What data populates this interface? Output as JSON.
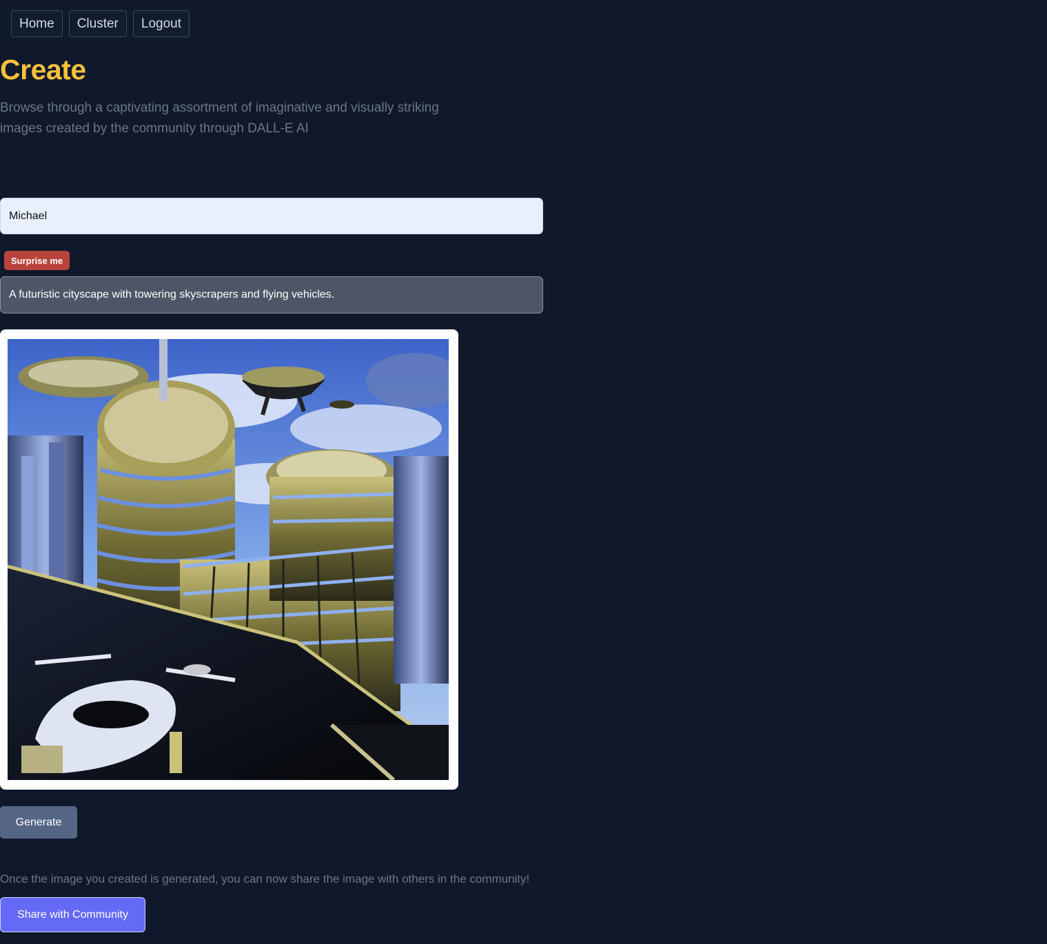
{
  "nav": {
    "items": [
      {
        "label": "Home"
      },
      {
        "label": "Cluster"
      },
      {
        "label": "Logout"
      }
    ]
  },
  "header": {
    "title": "Create",
    "subtitle": "Browse through a captivating assortment of imaginative and visually striking images created by the community through DALL-E AI"
  },
  "form": {
    "name_value": "Michael",
    "surprise_label": "Surprise me",
    "prompt_value": "A futuristic cityscape with towering skyscrapers and flying vehicles.",
    "generate_label": "Generate"
  },
  "share": {
    "note": "Once the image you created is generated, you can now share the image with others in the community!",
    "button_label": "Share with Community"
  },
  "colors": {
    "background": "#0f192b",
    "title_accent": "#fbbf3c",
    "surprise_button": "#b9443d",
    "generate_button": "#556685",
    "share_button": "#6469f6"
  },
  "icons": {
    "generated_image": "futuristic-city-image"
  }
}
